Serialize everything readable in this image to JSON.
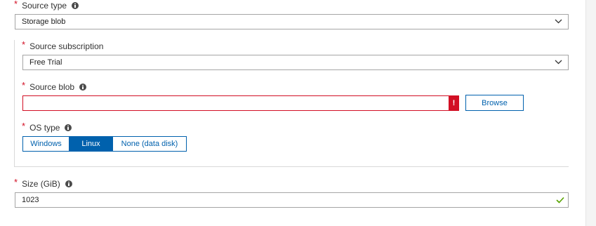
{
  "source_type": {
    "required_mark": "*",
    "label": "Source type",
    "value": "Storage blob"
  },
  "source_subscription": {
    "required_mark": "*",
    "label": "Source subscription",
    "value": "Free Trial"
  },
  "source_blob": {
    "required_mark": "*",
    "label": "Source blob",
    "value": "",
    "error_glyph": "!",
    "browse_label": "Browse"
  },
  "os_type": {
    "required_mark": "*",
    "label": "OS type",
    "options": [
      "Windows",
      "Linux",
      "None (data disk)"
    ],
    "selected": "Linux"
  },
  "size": {
    "required_mark": "*",
    "label": "Size (GiB)",
    "value": "1023"
  },
  "colors": {
    "accent": "#0061ad",
    "error": "#d20f24",
    "valid": "#57a300",
    "required": "#d20f24"
  },
  "icons": {
    "info": "info-icon",
    "dropdown": "chevron-down-icon",
    "error": "error-icon",
    "valid": "checkmark-icon"
  }
}
